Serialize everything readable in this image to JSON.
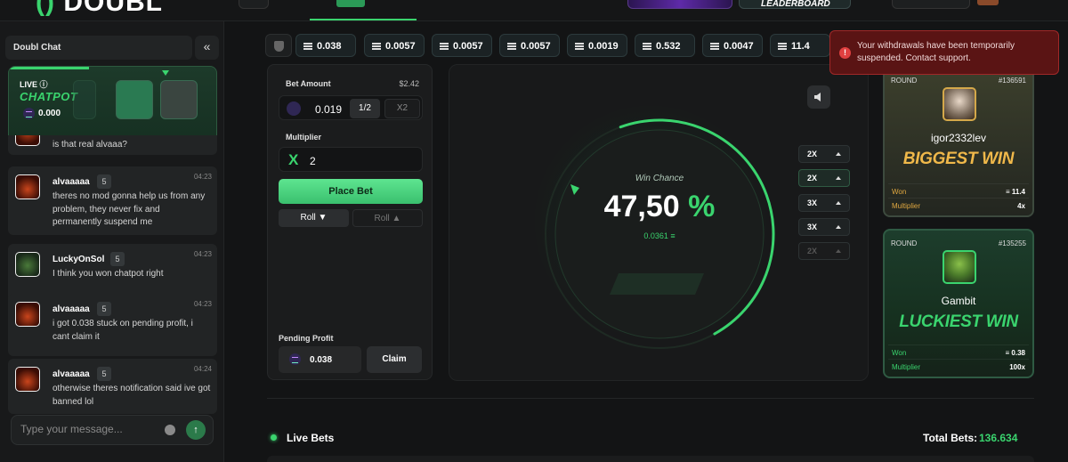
{
  "topbar": {
    "logo_text": "DOUBL",
    "leaderboard_label": "LEADERBOARD"
  },
  "chat": {
    "title": "Doubl Chat",
    "collapse_icon": "«",
    "chatpot": {
      "live_label": "LIVE",
      "title": "CHATPOT",
      "value": "0.000"
    },
    "truncated_message": "is that real alvaaa?",
    "messages": [
      {
        "user": "alvaaaaa",
        "level": "5",
        "time": "04:23",
        "text": "theres no mod gonna help us from any problem, they never fix and permanently suspend me"
      },
      {
        "user": "LuckyOnSol",
        "level": "5",
        "time": "04:23",
        "text": "I think you won chatpot right"
      },
      {
        "user": "alvaaaaa",
        "level": "5",
        "time": "04:23",
        "text": "i got 0.038 stuck on pending profit, i cant claim it"
      },
      {
        "user": "alvaaaaa",
        "level": "5",
        "time": "04:24",
        "text": "otherwise theres notification said ive got banned lol"
      }
    ],
    "input_placeholder": "Type your message...",
    "send_icon": "↑"
  },
  "chips": [
    "0.038",
    "0.0057",
    "0.0057",
    "0.0057",
    "0.0019",
    "0.532",
    "0.0047",
    "11.4"
  ],
  "bet": {
    "amount_label": "Bet Amount",
    "balance": "$2.42",
    "amount": "0.019",
    "half_label": "1/2",
    "double_label": "X2",
    "multiplier_label": "Multiplier",
    "multiplier_prefix": "X",
    "multiplier": "2",
    "place_label": "Place Bet",
    "roll_under_label": "Roll ▼",
    "roll_over_label": "Roll ▲",
    "pending_label": "Pending Profit",
    "pending_value": "0.038",
    "claim_label": "Claim"
  },
  "game": {
    "win_chance_label": "Win Chance",
    "win_chance_value": "47,50",
    "win_chance_unit": "%",
    "payout": "0.0361 ≡",
    "win_chance_fraction": 0.475,
    "multipliers": [
      "2X",
      "2X",
      "3X",
      "3X",
      "2X"
    ]
  },
  "cards": {
    "biggest": {
      "round_label": "ROUND",
      "round_id": "#136591",
      "user": "igor2332lev",
      "title": "BIGGEST WIN",
      "won_label": "Won",
      "won_value": "≡ 11.4",
      "mult_label": "Multiplier",
      "mult_value": "4x"
    },
    "luckiest": {
      "round_label": "ROUND",
      "round_id": "#135255",
      "user": "Gambit",
      "title": "LUCKIEST WIN",
      "won_label": "Won",
      "won_value": "≡ 0.38",
      "mult_label": "Multiplier",
      "mult_value": "100x"
    }
  },
  "toast": {
    "icon": "!",
    "text": "Your withdrawals have been temporarily suspended. Contact support."
  },
  "footer": {
    "live_bets_label": "Live Bets",
    "total_bets_label": "Total Bets:",
    "total_bets_value": "136.634"
  },
  "colors": {
    "accent": "#3ad46e",
    "gold": "#f0b84a",
    "error": "#a02828",
    "background": "#131415"
  }
}
